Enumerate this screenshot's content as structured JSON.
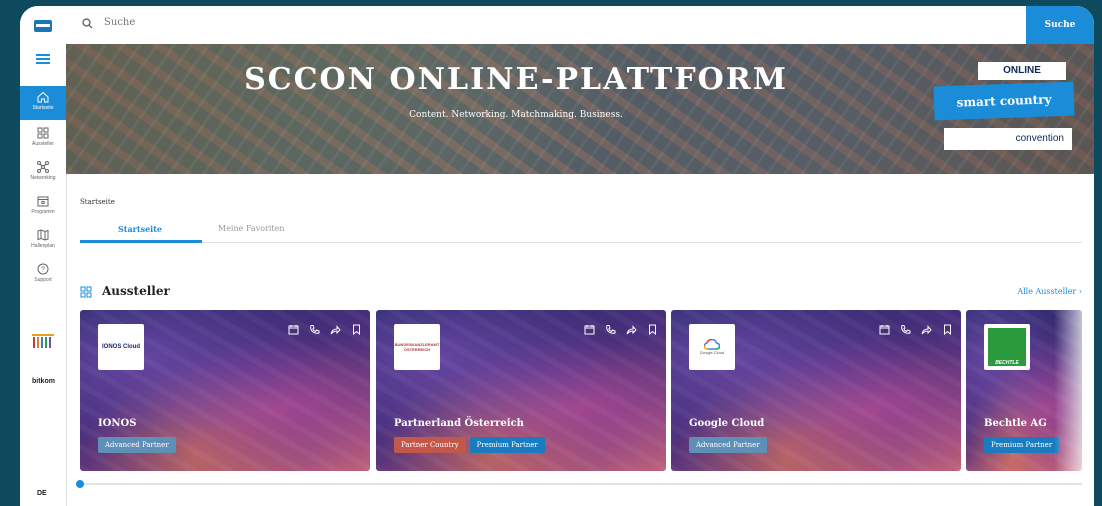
{
  "search": {
    "placeholder": "Suche",
    "button_label": "Suche"
  },
  "sidebar": {
    "items": [
      {
        "label": "Startseite",
        "icon": "home-icon",
        "active": true
      },
      {
        "label": "Aussteller",
        "icon": "grid-icon"
      },
      {
        "label": "Networking",
        "icon": "network-icon"
      },
      {
        "label": "Programm",
        "icon": "calendar-star-icon"
      },
      {
        "label": "Hallenplan",
        "icon": "map-icon"
      },
      {
        "label": "Support",
        "icon": "help-icon"
      }
    ],
    "sponsor_bitkom": "bitkom",
    "language": "DE"
  },
  "hero": {
    "title": "SCCON ONLINE-PLATTFORM",
    "subtitle": "Content. Networking. Matchmaking. Business.",
    "brand_online": "ONLINE",
    "brand_main": "smart country",
    "brand_convention": "convention"
  },
  "breadcrumb": "Startseite",
  "tabs": [
    {
      "label": "Startseite",
      "active": true
    },
    {
      "label": "Meine Favoriten"
    }
  ],
  "section": {
    "title": "Aussteller",
    "link_label": "Alle Aussteller"
  },
  "exhibitors": [
    {
      "name": "IONOS",
      "logo_text": "IONOS Cloud",
      "badges": [
        {
          "label": "Advanced Partner",
          "type": "adv"
        }
      ]
    },
    {
      "name": "Partnerland Österreich",
      "logo_text": "BUNDESKANZLERAMT ÖSTERREICH",
      "badges": [
        {
          "label": "Partner Country",
          "type": "pc"
        },
        {
          "label": "Premium Partner",
          "type": "prem"
        }
      ]
    },
    {
      "name": "Google Cloud",
      "logo_text": "Google Cloud",
      "badges": [
        {
          "label": "Advanced Partner",
          "type": "adv"
        }
      ]
    },
    {
      "name": "Bechtle AG",
      "logo_text": "BECHTLE",
      "badges": [
        {
          "label": "Premium Partner",
          "type": "prem"
        }
      ]
    }
  ],
  "colors": {
    "accent": "#1a8cd8",
    "background": "#0e4a5e"
  }
}
